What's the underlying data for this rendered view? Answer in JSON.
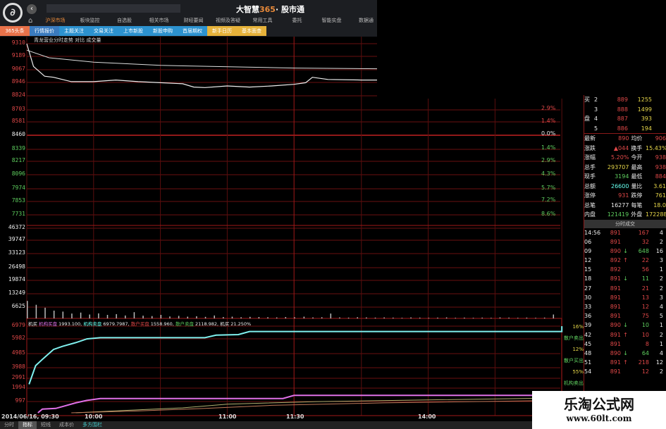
{
  "app": {
    "brand_main": "大智慧",
    "brand_365": "365",
    "brand_sub": "· 股市通",
    "logo_glyph": "∂"
  },
  "menu": [
    "沪深市场",
    "板块监控",
    "自选股",
    "相关市场",
    "财经要闻",
    "视频及答疑",
    "常用工具",
    "委托",
    "智能实盘",
    "数据通"
  ],
  "submenu": [
    "365头条",
    "行情报价",
    "主题关注",
    "交易关注",
    "上市新股",
    "新股申购",
    "首届期权",
    "新手日历",
    "基本面查"
  ],
  "chart_title": "青龙营业分时走势 对比 成交量",
  "price_axis": [
    "9310",
    "9189",
    "9067",
    "8946",
    "8824",
    "8703",
    "8581",
    "8460",
    "8339",
    "8217",
    "8096",
    "7974",
    "7853",
    "7731"
  ],
  "pct_axis": [
    "2.9%",
    "1.4%",
    "0.0%",
    "1.4%",
    "2.9%",
    "4.3%",
    "5.7%",
    "7.2%",
    "8.6%"
  ],
  "volume_axis": [
    "46372",
    "39747",
    "33123",
    "26498",
    "19874",
    "13249",
    "6625"
  ],
  "indicator_axis": [
    "6979",
    "5982",
    "4985",
    "3988",
    "2991",
    "1994",
    "997"
  ],
  "legend": {
    "a": "机买",
    "b": "机构买盘",
    "bv": "1993.100,",
    "c": "机构卖盘",
    "cv": "6979.7987,",
    "d": "散户买盘",
    "dv": "1558.960,",
    "e": "散户卖盘",
    "ev": "2118.982,",
    "f": "机买",
    "fv": "21.250%"
  },
  "indicator_side": [
    "16%",
    "散户卖出",
    "12%",
    "散户买出",
    "55%",
    "机构卖出"
  ],
  "time_axis": [
    "2014/06/16, 09:30",
    "10:00",
    "11:00",
    "11:30",
    "14:00"
  ],
  "bottom_tabs": [
    "分时",
    "指标",
    "短线",
    "成本价",
    "多方围栏"
  ],
  "order_book": [
    {
      "side": "买",
      "lv": "2",
      "price": "889",
      "vol": "1255"
    },
    {
      "side": "",
      "lv": "3",
      "price": "888",
      "vol": "1499"
    },
    {
      "side": "盘",
      "lv": "4",
      "price": "887",
      "vol": "393"
    },
    {
      "side": "",
      "lv": "5",
      "price": "886",
      "vol": "194"
    }
  ],
  "stats": [
    {
      "l1": "最新",
      "v1": "890",
      "l2": "均价",
      "v2": "906"
    },
    {
      "l1": "涨跌",
      "v1": "▲044",
      "l2": "换手",
      "v2": "15.43%"
    },
    {
      "l1": "涨幅",
      "v1": "5.20%",
      "l2": "今开",
      "v2": "938"
    },
    {
      "l1": "总手",
      "v1": "293707",
      "l2": "最高",
      "v2": "938"
    },
    {
      "l1": "现手",
      "v1": "3194",
      "l2": "最低",
      "v2": "884"
    },
    {
      "l1": "总额",
      "v1": "26600",
      "l2": "量比",
      "v2": "3.61"
    },
    {
      "l1": "涨停",
      "v1": "931",
      "l2": "跌停",
      "v2": "761"
    },
    {
      "l1": "总笔",
      "v1": "16277",
      "l2": "每笔",
      "v2": "18.0"
    },
    {
      "l1": "内盘",
      "v1": "121419",
      "l2": "外盘",
      "v2": "172288"
    }
  ],
  "tick_header": "分时成交",
  "ticks": [
    {
      "t": "14:56",
      "p": "891",
      "d": "",
      "v": "167",
      "n": "4"
    },
    {
      "t": "06",
      "p": "891",
      "d": "",
      "v": "32",
      "n": "2"
    },
    {
      "t": "09",
      "p": "890",
      "d": "↓",
      "v": "648",
      "n": "16"
    },
    {
      "t": "12",
      "p": "892",
      "d": "↑",
      "v": "22",
      "n": "3"
    },
    {
      "t": "15",
      "p": "892",
      "d": "",
      "v": "56",
      "n": "1"
    },
    {
      "t": "18",
      "p": "891",
      "d": "↓",
      "v": "11",
      "n": "2"
    },
    {
      "t": "27",
      "p": "891",
      "d": "",
      "v": "21",
      "n": "2"
    },
    {
      "t": "30",
      "p": "891",
      "d": "",
      "v": "13",
      "n": "3"
    },
    {
      "t": "33",
      "p": "891",
      "d": "",
      "v": "12",
      "n": "4"
    },
    {
      "t": "36",
      "p": "891",
      "d": "",
      "v": "75",
      "n": "5"
    },
    {
      "t": "39",
      "p": "890",
      "d": "↓",
      "v": "10",
      "n": "1"
    },
    {
      "t": "42",
      "p": "891",
      "d": "↑",
      "v": "10",
      "n": "2"
    },
    {
      "t": "45",
      "p": "891",
      "d": "",
      "v": "8",
      "n": "1"
    },
    {
      "t": "48",
      "p": "890",
      "d": "↓",
      "v": "64",
      "n": "4"
    },
    {
      "t": "51",
      "p": "891",
      "d": "↑",
      "v": "218",
      "n": "12"
    },
    {
      "t": "54",
      "p": "891",
      "d": "",
      "v": "12",
      "n": "2"
    }
  ],
  "watermark": {
    "title": "乐淘公式网",
    "url": "www.60lt.com"
  },
  "chart_data": {
    "type": "line",
    "x_unit": "minutes since 09:30",
    "price_range": [
      7731,
      9310
    ],
    "price": [
      [
        0,
        9310
      ],
      [
        3,
        9100
      ],
      [
        8,
        9010
      ],
      [
        12,
        9000
      ],
      [
        20,
        8960
      ],
      [
        30,
        8960
      ],
      [
        40,
        8975
      ],
      [
        50,
        8960
      ],
      [
        60,
        8950
      ],
      [
        70,
        8940
      ],
      [
        75,
        8910
      ],
      [
        80,
        8905
      ],
      [
        90,
        8920
      ],
      [
        100,
        8910
      ],
      [
        110,
        8920
      ],
      [
        120,
        8935
      ],
      [
        125,
        8950
      ],
      [
        128,
        9000
      ],
      [
        135,
        8980
      ],
      [
        150,
        8975
      ],
      [
        170,
        8975
      ],
      [
        190,
        8970
      ],
      [
        210,
        8965
      ],
      [
        230,
        8955
      ],
      [
        240,
        8950
      ]
    ],
    "avg_price": [
      [
        0,
        9250
      ],
      [
        10,
        9180
      ],
      [
        30,
        9140
      ],
      [
        60,
        9110
      ],
      [
        120,
        9085
      ],
      [
        180,
        9075
      ],
      [
        240,
        9070
      ]
    ],
    "volume_range": [
      0,
      46372
    ],
    "volume": [
      9000,
      7000,
      5500,
      4000,
      3500,
      2500,
      3000,
      2000,
      2600,
      1800,
      2200,
      1500,
      3200,
      1400,
      1200,
      1800,
      1000,
      1300,
      900,
      1100,
      800,
      1500,
      700,
      900,
      600,
      800,
      700,
      600,
      500,
      700,
      600,
      900,
      500,
      600,
      2500,
      500,
      400,
      600,
      500,
      400,
      500,
      400,
      300,
      500,
      400,
      300,
      400,
      500,
      300,
      400,
      300,
      400,
      300,
      500,
      400,
      300,
      400,
      300,
      400,
      2000
    ],
    "indicator_range": [
      0,
      6979
    ],
    "series": [
      {
        "name": "机构卖盘",
        "color": "#7ff0ee",
        "points": [
          [
            1,
            2300
          ],
          [
            4,
            3800
          ],
          [
            7,
            4300
          ],
          [
            12,
            5100
          ],
          [
            16,
            5350
          ],
          [
            22,
            5650
          ],
          [
            27,
            5950
          ],
          [
            33,
            6050
          ],
          [
            80,
            6050
          ],
          [
            85,
            6250
          ],
          [
            95,
            6300
          ],
          [
            100,
            6550
          ],
          [
            240,
            6550
          ],
          [
            240,
            6979
          ]
        ]
      },
      {
        "name": "机构买盘",
        "color": "#e070e8",
        "points": [
          [
            5,
            0
          ],
          [
            7,
            300
          ],
          [
            13,
            350
          ],
          [
            17,
            550
          ],
          [
            22,
            800
          ],
          [
            27,
            1000
          ],
          [
            33,
            1150
          ],
          [
            115,
            1150
          ],
          [
            120,
            1400
          ],
          [
            130,
            1400
          ],
          [
            240,
            1400
          ]
        ]
      },
      {
        "name": "散户卖盘",
        "color": "#b0b070",
        "points": [
          [
            22,
            0
          ],
          [
            45,
            200
          ],
          [
            70,
            400
          ],
          [
            90,
            700
          ],
          [
            130,
            900
          ],
          [
            240,
            1200
          ]
        ]
      },
      {
        "name": "散户买盘",
        "color": "#c07a5a",
        "points": [
          [
            20,
            0
          ],
          [
            50,
            150
          ],
          [
            80,
            350
          ],
          [
            110,
            600
          ],
          [
            160,
            800
          ],
          [
            240,
            1000
          ]
        ]
      }
    ]
  }
}
